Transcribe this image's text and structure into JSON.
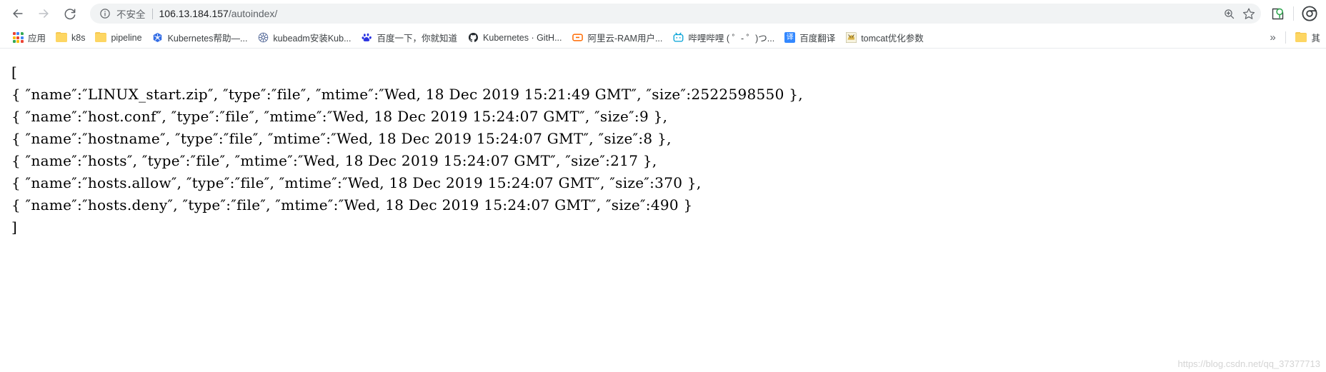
{
  "window": {
    "title": "106.13.184.157/autoindex/"
  },
  "toolbar": {
    "back_label": "back-arrow",
    "forward_label": "forward-arrow",
    "reload_label": "reload",
    "security_label": "不安全",
    "url_host": "106.13.184.157",
    "url_path": "/autoindex/",
    "zoom_action_label": "zoom-in",
    "bookmark_action_label": "star",
    "profile_label": "profile",
    "menu_label": "chrome-menu"
  },
  "bookmarks": {
    "items": [
      {
        "label": "应用",
        "icon": "apps-grid",
        "color": "#4285f4"
      },
      {
        "label": "k8s",
        "icon": "folder",
        "color": "#fdd663"
      },
      {
        "label": "pipeline",
        "icon": "folder",
        "color": "#fdd663"
      },
      {
        "label": "Kubernetes帮助—...",
        "icon": "kubernetes",
        "color": "#326ce5"
      },
      {
        "label": "kubeadm安装Kub...",
        "icon": "kubernetes",
        "color": "#4a5f8e"
      },
      {
        "label": "百度一下，你就知道",
        "icon": "baidu",
        "color": "#2932e1"
      },
      {
        "label": "Kubernetes · GitH...",
        "icon": "github",
        "color": "#24292e"
      },
      {
        "label": "阿里云-RAM用户...",
        "icon": "aliyun",
        "color": "#ff6a00"
      },
      {
        "label": "哔哩哔哩 ( ゜- ゜)つ...",
        "icon": "bilibili",
        "color": "#00a1d6"
      },
      {
        "label": "百度翻译",
        "icon": "fanyi",
        "color": "#3388ff"
      },
      {
        "label": "tomcat优化参数",
        "icon": "tomcat",
        "color": "#f8dc75"
      }
    ],
    "overflow_label": "»",
    "other_bookmarks_label": "其",
    "other_bookmarks_icon": "folder"
  },
  "page": {
    "json_text": "[\n{ ″name″:″LINUX_start.zip″, ″type″:″file″, ″mtime″:″Wed, 18 Dec 2019 15:21:49 GMT″, ″size″:2522598550 },\n{ ″name″:″host.conf″, ″type″:″file″, ″mtime″:″Wed, 18 Dec 2019 15:24:07 GMT″, ″size″:9 },\n{ ″name″:″hostname″, ″type″:″file″, ″mtime″:″Wed, 18 Dec 2019 15:24:07 GMT″, ″size″:8 },\n{ ″name″:″hosts″, ″type″:″file″, ″mtime″:″Wed, 18 Dec 2019 15:24:07 GMT″, ″size″:217 },\n{ ″name″:″hosts.allow″, ″type″:″file″, ″mtime″:″Wed, 18 Dec 2019 15:24:07 GMT″, ″size″:370 },\n{ ″name″:″hosts.deny″, ″type″:″file″, ″mtime″:″Wed, 18 Dec 2019 15:24:07 GMT″, ″size″:490 }\n]",
    "entries": [
      {
        "name": "LINUX_start.zip",
        "type": "file",
        "mtime": "Wed, 18 Dec 2019 15:21:49 GMT",
        "size": 2522598550
      },
      {
        "name": "host.conf",
        "type": "file",
        "mtime": "Wed, 18 Dec 2019 15:24:07 GMT",
        "size": 9
      },
      {
        "name": "hostname",
        "type": "file",
        "mtime": "Wed, 18 Dec 2019 15:24:07 GMT",
        "size": 8
      },
      {
        "name": "hosts",
        "type": "file",
        "mtime": "Wed, 18 Dec 2019 15:24:07 GMT",
        "size": 217
      },
      {
        "name": "hosts.allow",
        "type": "file",
        "mtime": "Wed, 18 Dec 2019 15:24:07 GMT",
        "size": 370
      },
      {
        "name": "hosts.deny",
        "type": "file",
        "mtime": "Wed, 18 Dec 2019 15:24:07 GMT",
        "size": 490
      }
    ],
    "watermark": "https://blog.csdn.net/qq_37377713"
  }
}
